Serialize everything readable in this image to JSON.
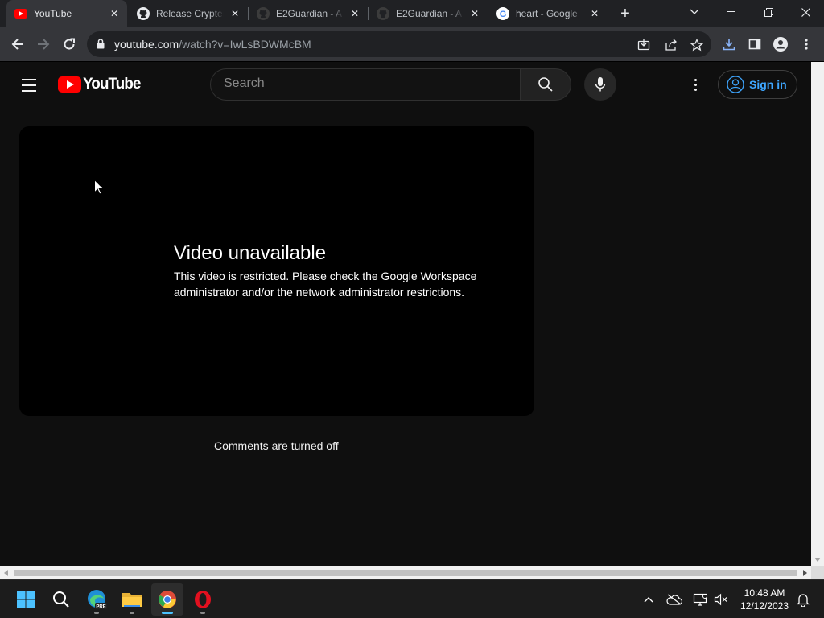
{
  "tabs": [
    {
      "title": "YouTube",
      "icon": "youtube-icon"
    },
    {
      "title": "Release Crypter",
      "icon": "github-icon"
    },
    {
      "title": "E2Guardian - A",
      "icon": "github-icon"
    },
    {
      "title": "E2Guardian - A",
      "icon": "github-icon"
    },
    {
      "title": "heart - Google",
      "icon": "google-icon"
    }
  ],
  "address_bar": {
    "domain": "youtube.com",
    "path": "/watch?v=IwLsBDWMcBM"
  },
  "youtube": {
    "logo_text": "YouTube",
    "search_placeholder": "Search",
    "sign_in_label": "Sign in"
  },
  "player": {
    "title": "Video unavailable",
    "message": "This video is restricted. Please check the Google Workspace administrator and/or the network administrator restrictions."
  },
  "comments_text": "Comments are turned off",
  "taskbar": {
    "apps": [
      "start-icon",
      "search-icon",
      "edge-beta-icon",
      "file-explorer-icon",
      "chrome-icon",
      "opera-icon"
    ],
    "time": "10:48 AM",
    "date": "12/12/2023"
  },
  "colors": {
    "youtube_red": "#ff0000",
    "link_blue": "#3ea6ff",
    "page_bg": "#0f0f0f",
    "chrome_dark": "#202124"
  }
}
